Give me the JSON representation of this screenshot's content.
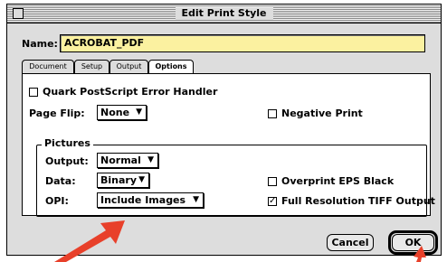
{
  "window": {
    "title": "Edit Print Style"
  },
  "name_field": {
    "label": "Name:",
    "value": "ACROBAT_PDF"
  },
  "tabs": [
    {
      "label": "Document",
      "active": false
    },
    {
      "label": "Setup",
      "active": false
    },
    {
      "label": "Output",
      "active": false
    },
    {
      "label": "Options",
      "active": true
    }
  ],
  "options": {
    "quark_error_handler": {
      "label": "Quark PostScript Error Handler",
      "checked": false
    },
    "page_flip": {
      "label": "Page Flip:",
      "value": "None"
    },
    "negative_print": {
      "label": "Negative Print",
      "checked": false
    }
  },
  "pictures": {
    "group_label": "Pictures",
    "output": {
      "label": "Output:",
      "value": "Normal"
    },
    "data": {
      "label": "Data:",
      "value": "Binary"
    },
    "opi": {
      "label": "OPI:",
      "value": "Include Images"
    },
    "overprint_eps_black": {
      "label": "Overprint EPS Black",
      "checked": false
    },
    "full_res_tiff": {
      "label": "Full Resolution TIFF Output",
      "checked": true
    }
  },
  "buttons": {
    "cancel": "Cancel",
    "ok": "OK"
  },
  "glyphs": {
    "popup_arrow": "▼",
    "checkmark": "✓"
  },
  "colors": {
    "name_field_bg": "#fbf1a0",
    "annotation_arrow": "#e8402a"
  },
  "icons": {
    "close_box": "close-box-icon",
    "annotation_arrows": "red-arrow-icon"
  }
}
